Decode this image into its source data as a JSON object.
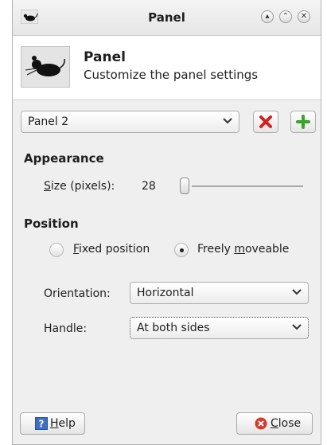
{
  "window": {
    "title": "Panel",
    "buttons": [
      "minimize-icon",
      "maximize-icon",
      "close-icon"
    ]
  },
  "header": {
    "title": "Panel",
    "subtitle": "Customize the panel settings"
  },
  "panel_selector": {
    "value": "Panel 2",
    "remove_icon": "red-x-icon",
    "add_icon": "green-plus-icon"
  },
  "appearance": {
    "title": "Appearance",
    "size_label_mnemonic": "S",
    "size_label_rest": "ize (pixels):",
    "size_value": "28",
    "size_slider_value": 28
  },
  "position": {
    "title": "Position",
    "fixed_mnemonic": "F",
    "fixed_rest": "ixed position",
    "freely_before": "Freely ",
    "freely_mnemonic": "m",
    "freely_rest": "oveable",
    "selected": "freely_moveable",
    "orientation_label": "Orientation:",
    "orientation_value": "Horizontal",
    "handle_label": "Handle:",
    "handle_value": "At both sides"
  },
  "footer": {
    "help_mnemonic": "H",
    "help_rest": "elp",
    "close_mnemonic": "C",
    "close_rest": "lose"
  }
}
